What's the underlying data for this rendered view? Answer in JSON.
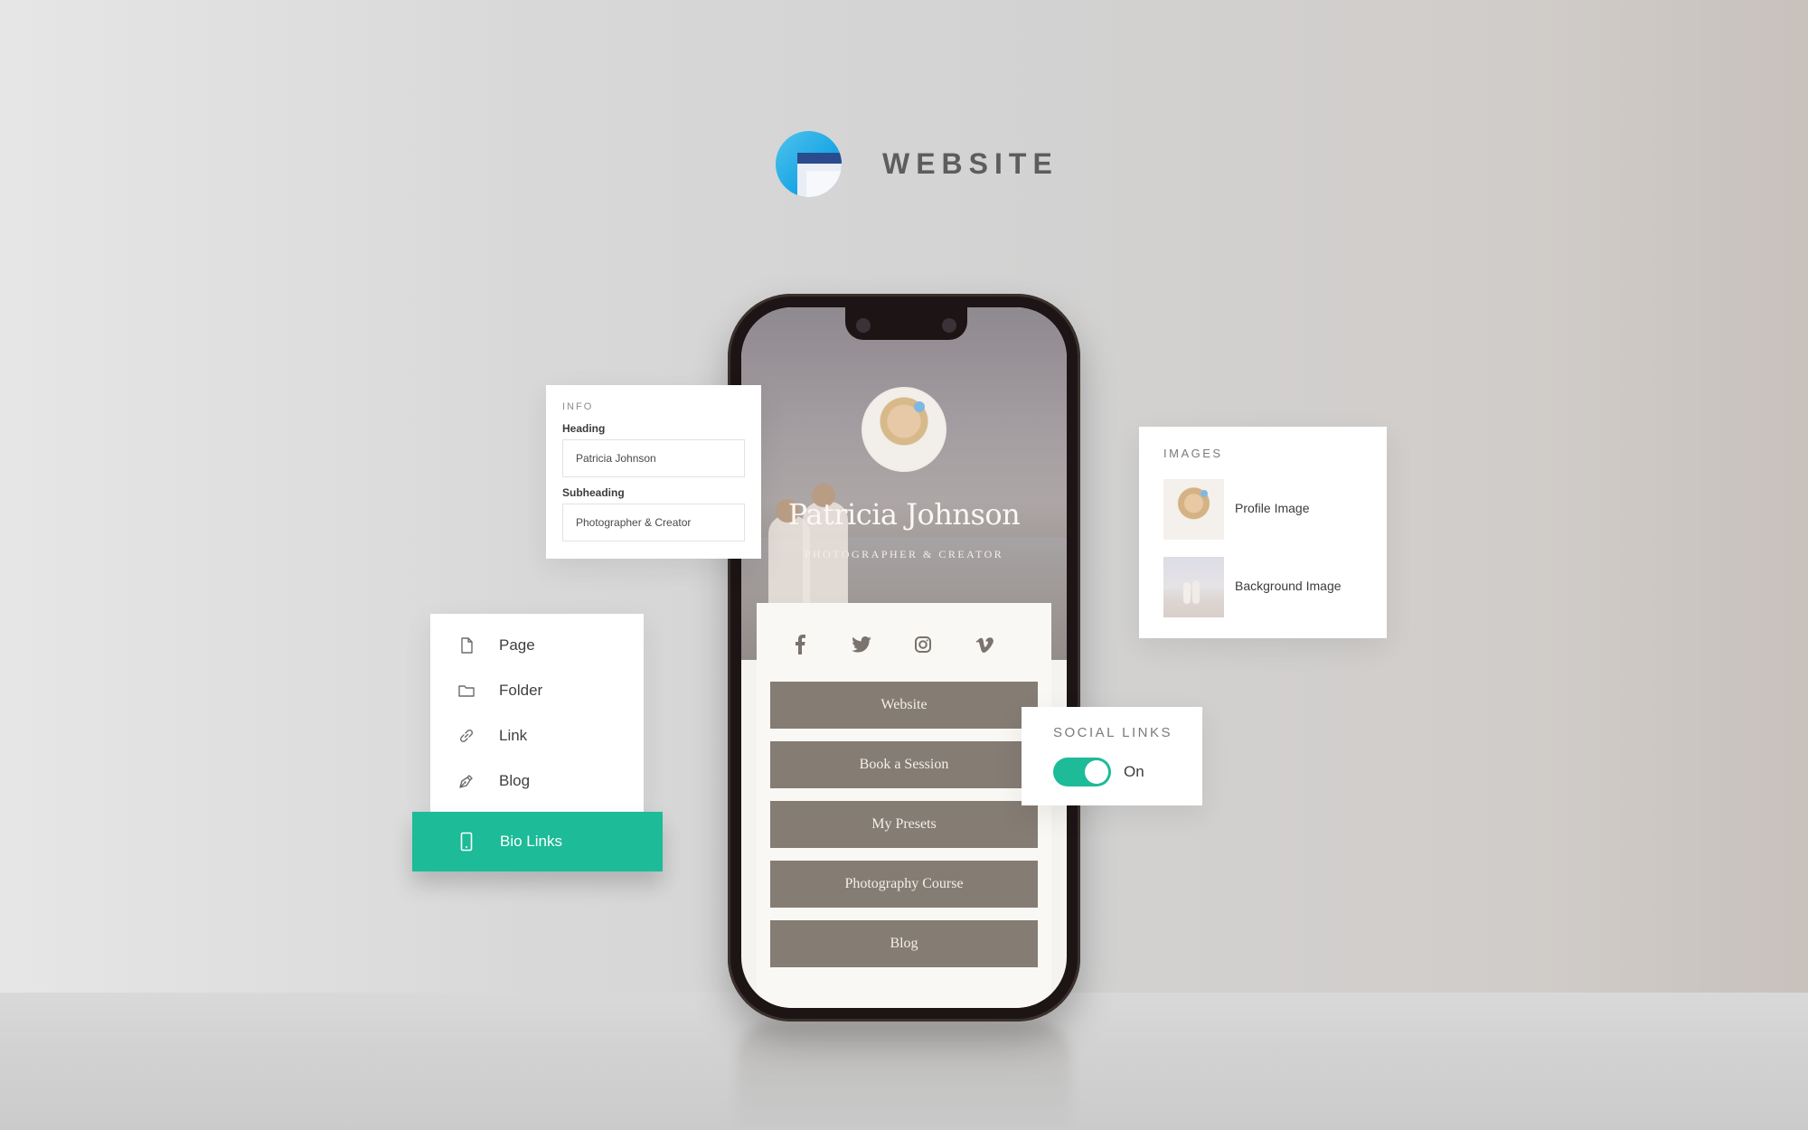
{
  "header": {
    "app_icon": "website-window-icon",
    "title": "WEBSITE"
  },
  "colors": {
    "accent": "#1dbb98",
    "link_button": "#857c74",
    "logo_blue": "#1aa6e4",
    "logo_navy": "#2b4b8e"
  },
  "phone": {
    "profile": {
      "name": "Patricia Johnson",
      "subtitle": "PHOTOGRAPHER & CREATOR"
    },
    "social_icons": [
      {
        "name": "facebook-icon",
        "glyph": "f"
      },
      {
        "name": "twitter-icon",
        "glyph": "🐦"
      },
      {
        "name": "instagram-icon",
        "glyph": "◎"
      },
      {
        "name": "vimeo-icon",
        "glyph": "v"
      }
    ],
    "links": [
      {
        "label": "Website"
      },
      {
        "label": "Book a Session"
      },
      {
        "label": "My Presets"
      },
      {
        "label": "Photography Course"
      },
      {
        "label": "Blog"
      }
    ]
  },
  "info_panel": {
    "kicker": "INFO",
    "heading_label": "Heading",
    "heading_value": "Patricia Johnson",
    "subheading_label": "Subheading",
    "subheading_value": "Photographer & Creator"
  },
  "menu": {
    "items": [
      {
        "label": "Page",
        "icon": "page-icon"
      },
      {
        "label": "Folder",
        "icon": "folder-icon"
      },
      {
        "label": "Link",
        "icon": "link-icon"
      },
      {
        "label": "Blog",
        "icon": "pen-nib-icon"
      }
    ],
    "selected": {
      "label": "Bio Links",
      "icon": "mobile-phone-icon"
    }
  },
  "images_panel": {
    "kicker": "IMAGES",
    "items": [
      {
        "label": "Profile Image"
      },
      {
        "label": "Background Image"
      }
    ]
  },
  "social_links_panel": {
    "kicker": "SOCIAL LINKS",
    "toggle_on": true,
    "state_label": "On"
  }
}
